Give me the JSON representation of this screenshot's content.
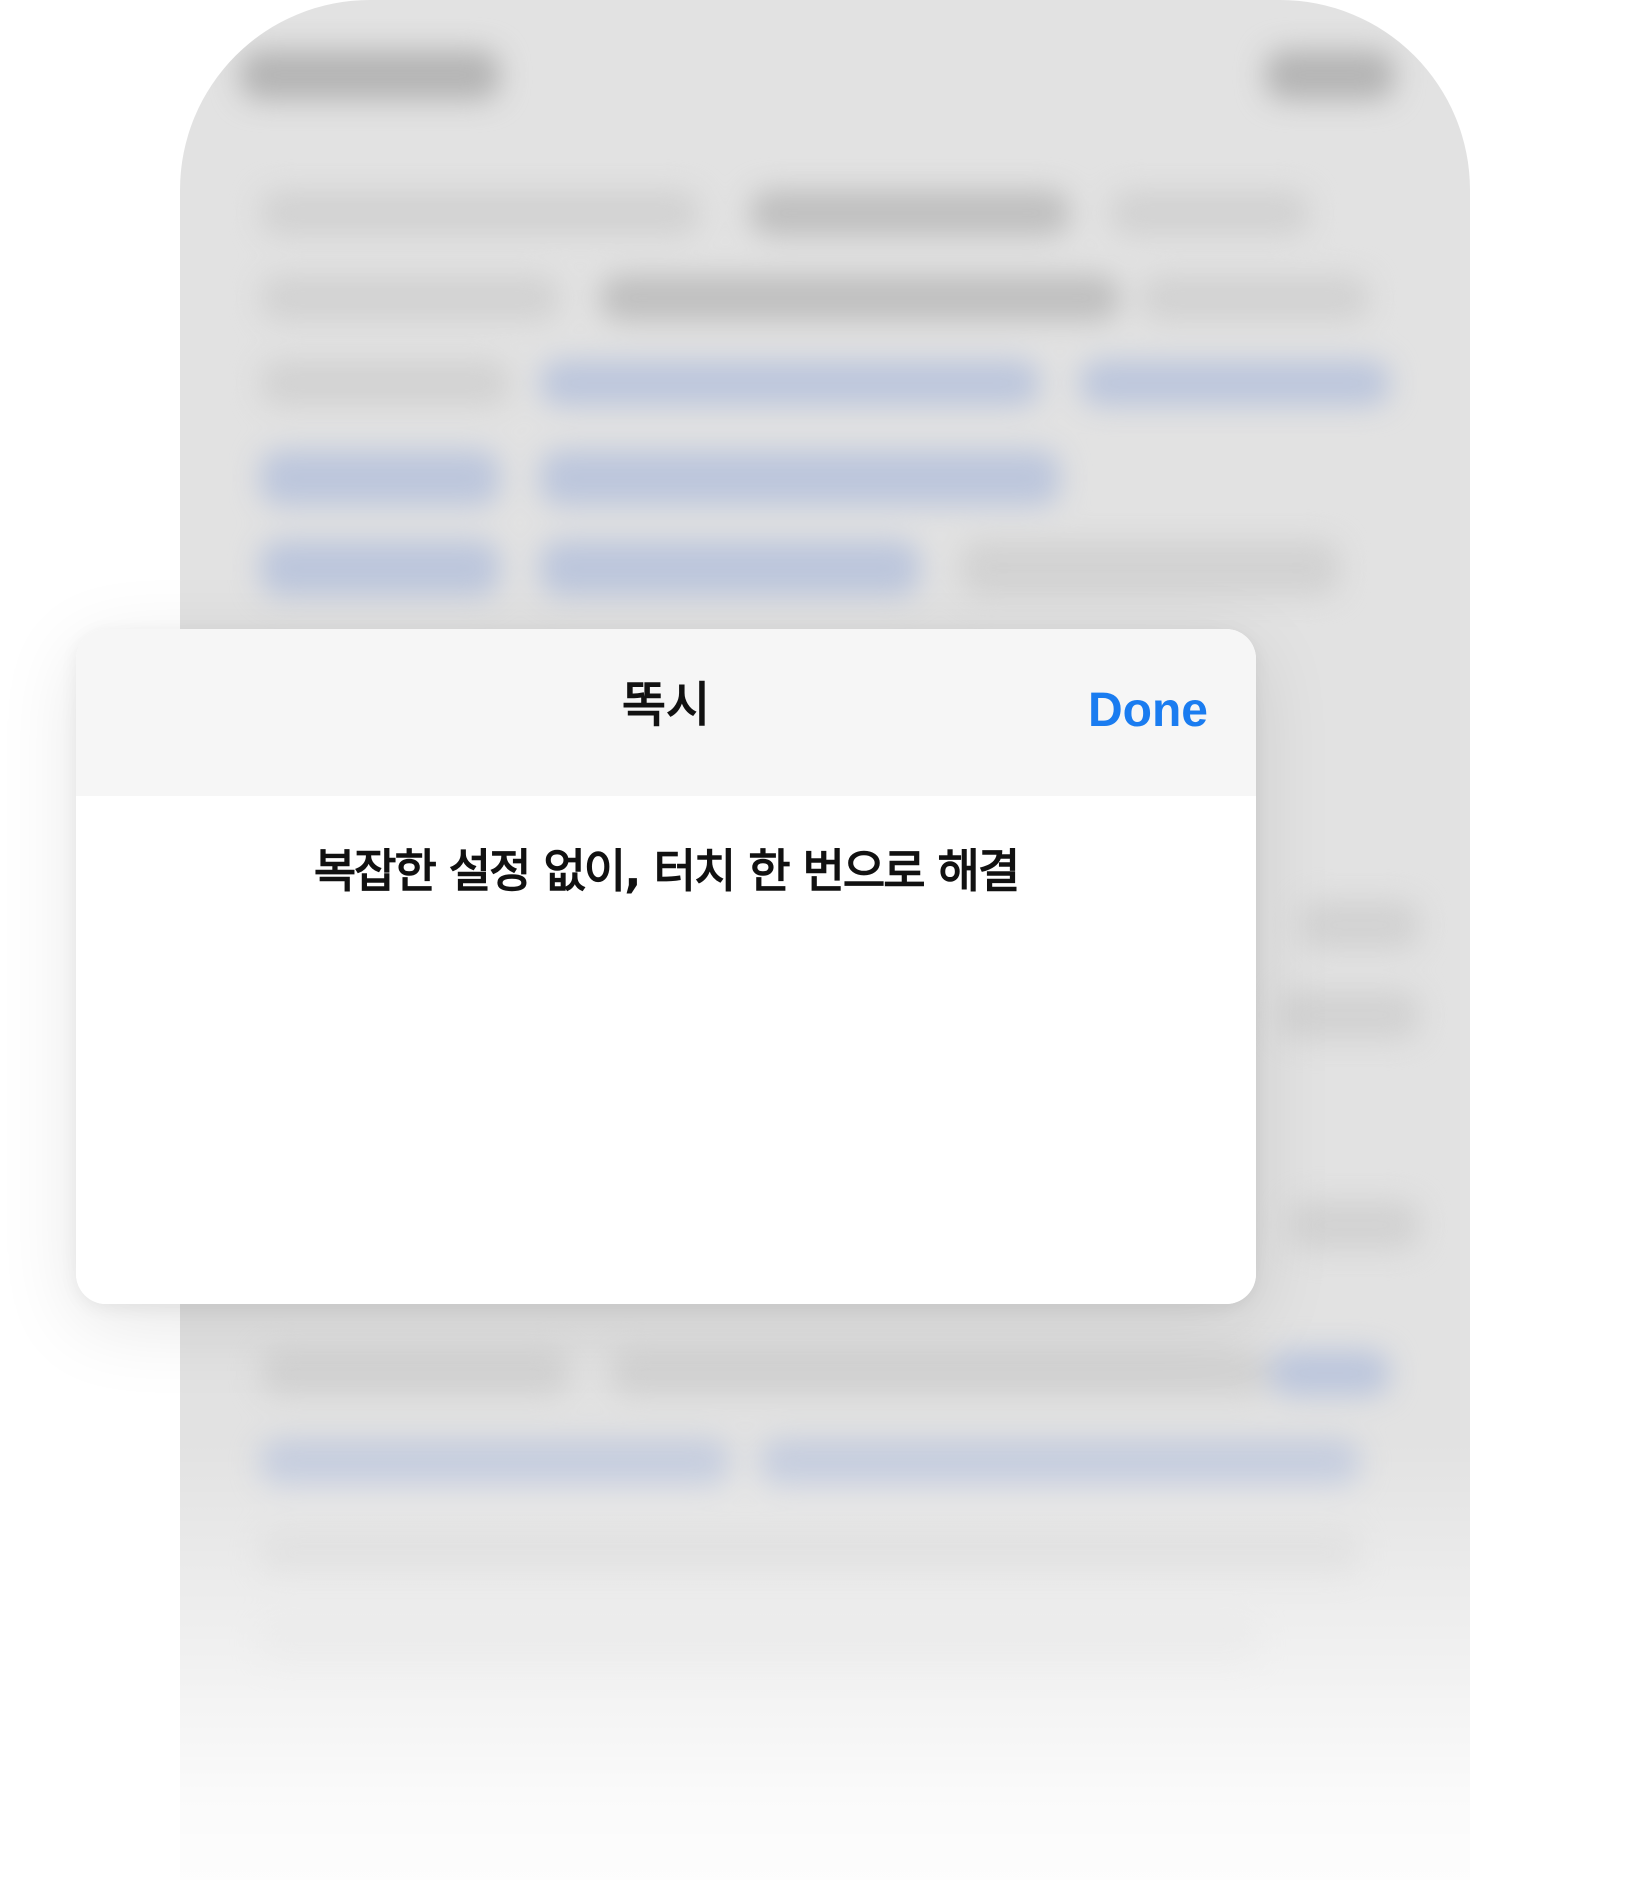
{
  "sheet": {
    "title": "똑시",
    "done_label": "Done",
    "message": "복잡한 설정 없이, 터치 한 번으로 해결"
  },
  "colors": {
    "accent": "#1a7cf0",
    "header_background": "#f6f6f6",
    "sheet_background": "#ffffff",
    "phone_background": "#e2e2e2"
  }
}
